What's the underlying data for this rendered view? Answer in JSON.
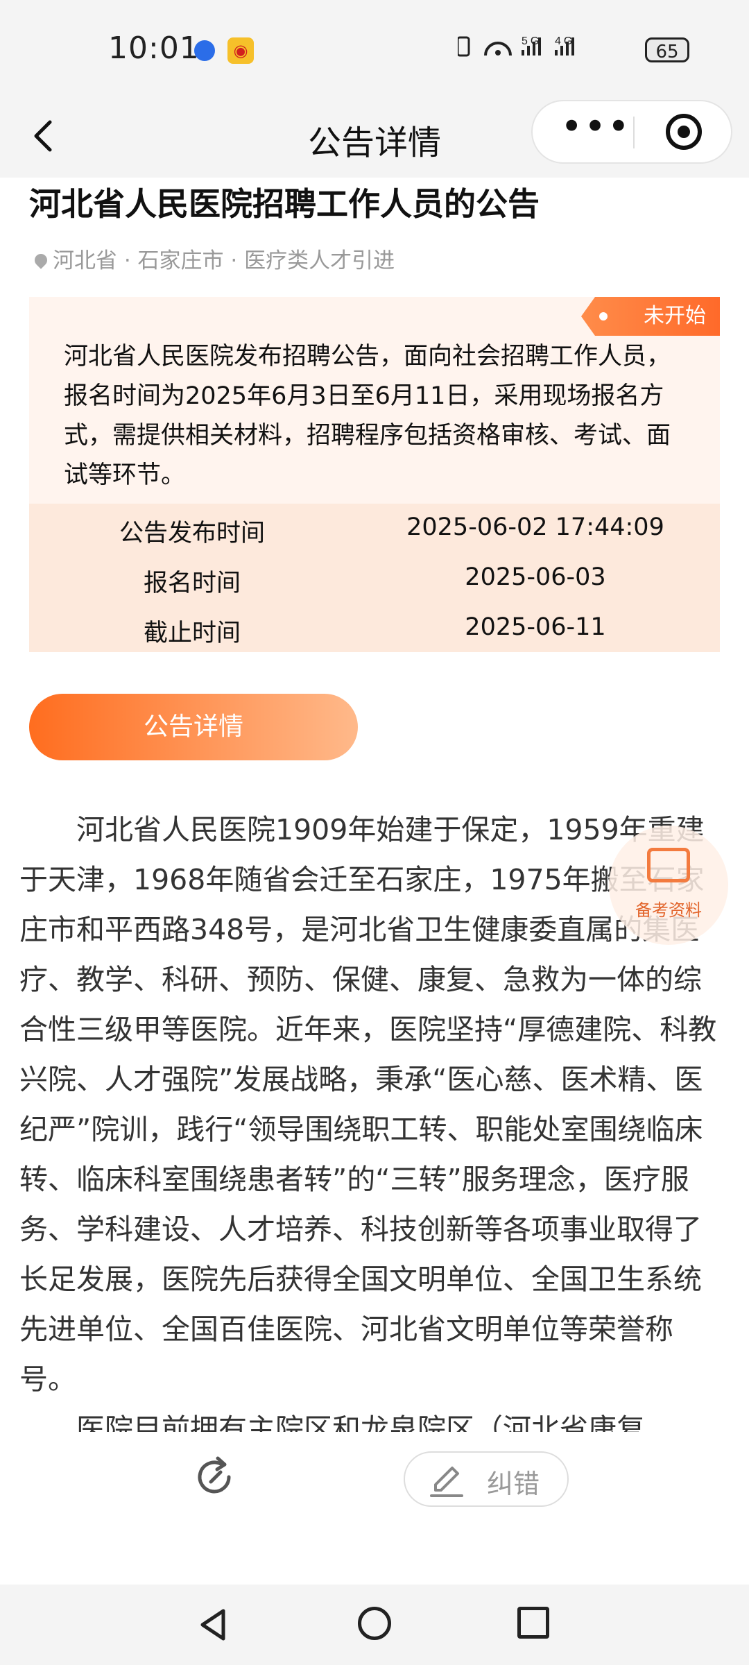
{
  "status_bar": {
    "time": "10:01",
    "network_icons": "􏿮 5G 4G",
    "battery": "65"
  },
  "header": {
    "title": "公告详情",
    "more_icon": "•••"
  },
  "notice": {
    "title": "河北省人民医院招聘工作人员的公告",
    "location": "河北省 · 石家庄市 · 医疗类人才引进",
    "status": "未开始",
    "summary": "河北省人民医院发布招聘公告，面向社会招聘工作人员，报名时间为2025年6月3日至6月11日，采用现场报名方式，需提供相关材料，招聘程序包括资格审核、考试、面试等环节。",
    "info": [
      {
        "label": "公告发布时间",
        "value": "2025-06-02 17:44:09"
      },
      {
        "label": "报名时间",
        "value": "2025-06-03"
      },
      {
        "label": "截止时间",
        "value": "2025-06-11"
      }
    ],
    "detail_button": "公告详情"
  },
  "article": {
    "paragraphs": [
      "河北省人民医院1909年始建于保定，1959年重建于天津，1968年随省会迁至石家庄，1975年搬至石家庄市和平西路348号，是河北省卫生健康委直属的集医疗、教学、科研、预防、保健、康复、急救为一体的综合性三级甲等医院。近年来，医院坚持“厚德建院、科教兴院、人才强院”发展战略，秉承“医心慈、医术精、医纪严”院训，践行“领导围绕职工转、职能处室围绕临床转、临床科室围绕患者转”的“三转”服务理念，医疗服务、学科建设、人才培养、科技创新等各项事业取得了长足发展，医院先后获得全国文明单位、全国卫生系统先进单位、全国百佳医院、河北省文明单位等荣誉称号。",
      "医院目前拥有主院区和龙泉院区（河北省康复"
    ]
  },
  "floating": {
    "label": "备考资料"
  },
  "bottom": {
    "report_label": "纠错"
  },
  "colors": {
    "accent": "#ff6d1f",
    "card_bg": "#fff4ee",
    "table_bg": "#fde9dc"
  }
}
